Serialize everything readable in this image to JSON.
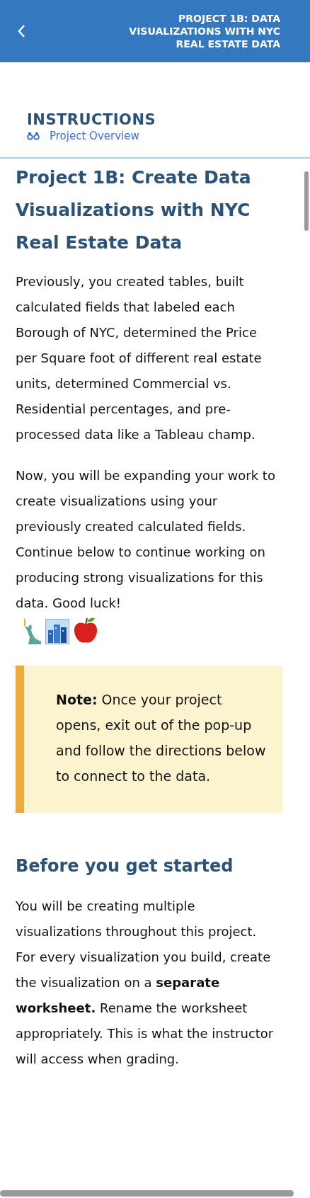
{
  "header": {
    "title": "PROJECT 1B: DATA VISUALIZATIONS WITH NYC REAL ESTATE DATA"
  },
  "section": {
    "heading": "INSTRUCTIONS",
    "link": "Project Overview"
  },
  "content": [
    {
      "kind": "title",
      "text": "Project 1B: Create Data Visualizations with NYC Real Estate Data"
    },
    {
      "kind": "paragraph",
      "text": "Previously, you created tables, built calculated fields that labeled each Borough of NYC, determined the Price per Square foot of different real estate units, determined Commercial vs. Residential percentages, and pre-processed data like a Tableau champ."
    },
    {
      "kind": "paragraph_icons",
      "text": "Now, you will be expanding your work to create visualizations using your previously created calculated fields. Continue below to continue working on producing strong visualizations for this data. Good luck!"
    },
    {
      "kind": "note",
      "text": "**Note:** Once your project opens, exit out of the pop-up and follow the directions below to connect to the data."
    },
    {
      "kind": "heading",
      "text": "Before you get started"
    },
    {
      "kind": "paragraph",
      "text": "You will be creating multiple visualizations throughout this project. For every visualization you build, create the visualization on a **separate worksheet.** Rename the worksheet appropriately. This is what the instructor will access when grading."
    }
  ]
}
